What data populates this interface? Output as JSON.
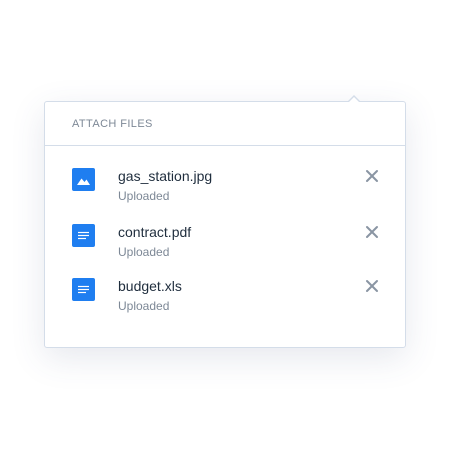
{
  "panel": {
    "title": "ATTACH FILES"
  },
  "files": [
    {
      "name": "gas_station.jpg",
      "status": "Uploaded",
      "icon": "image-file-icon"
    },
    {
      "name": "contract.pdf",
      "status": "Uploaded",
      "icon": "document-file-icon"
    },
    {
      "name": "budget.xls",
      "status": "Uploaded",
      "icon": "document-file-icon"
    }
  ],
  "colors": {
    "accent": "#1f7ef0",
    "border": "#d4dde9",
    "text_primary": "#1f2d3d",
    "text_secondary": "#7d8896",
    "close_icon": "#8a95a3"
  }
}
